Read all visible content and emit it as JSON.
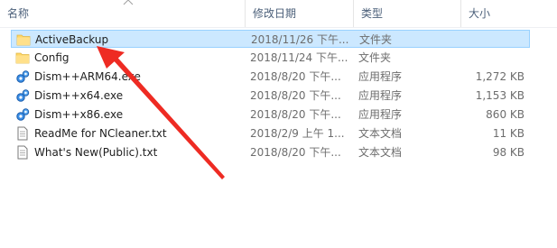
{
  "columns": {
    "name": "名称",
    "date": "修改日期",
    "type": "类型",
    "size": "大小"
  },
  "files": [
    {
      "name": "ActiveBackup",
      "date": "2018/11/26 下午...",
      "type": "文件夹",
      "size": "",
      "icon": "folder-icon",
      "selected": true
    },
    {
      "name": "Config",
      "date": "2018/11/24 下午...",
      "type": "文件夹",
      "size": "",
      "icon": "folder-icon",
      "selected": false
    },
    {
      "name": "Dism++ARM64.exe",
      "date": "2018/8/20 下午...",
      "type": "应用程序",
      "size": "1,272 KB",
      "icon": "exe-gear-icon",
      "selected": false
    },
    {
      "name": "Dism++x64.exe",
      "date": "2018/8/20 下午...",
      "type": "应用程序",
      "size": "1,153 KB",
      "icon": "exe-gear-icon",
      "selected": false
    },
    {
      "name": "Dism++x86.exe",
      "date": "2018/8/20 下午...",
      "type": "应用程序",
      "size": "860 KB",
      "icon": "exe-gear-icon",
      "selected": false
    },
    {
      "name": "ReadMe for NCleaner.txt",
      "date": "2018/2/9 上午 1...",
      "type": "文本文档",
      "size": "11 KB",
      "icon": "text-file-icon",
      "selected": false
    },
    {
      "name": "What's New(Public).txt",
      "date": "2018/8/20 下午...",
      "type": "文本文档",
      "size": "98 KB",
      "icon": "text-file-icon",
      "selected": false
    }
  ],
  "annotation": {
    "color": "#ee2b23",
    "icon": "red-arrow-annotation"
  }
}
